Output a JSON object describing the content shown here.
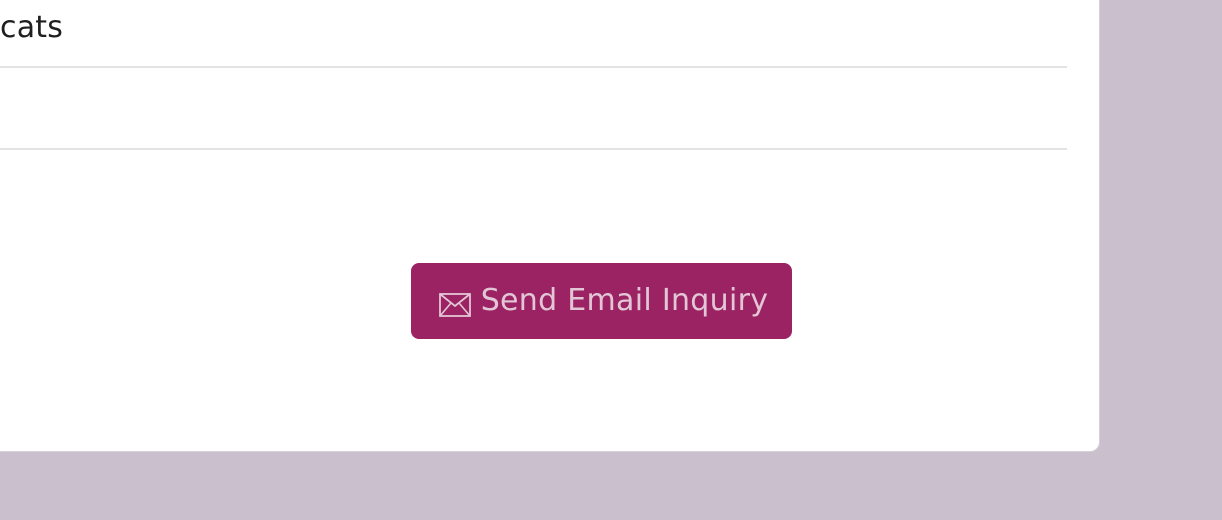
{
  "row": {
    "text": "cats"
  },
  "actions": {
    "send_email_label": "Send Email Inquiry",
    "send_email_icon": "envelope-icon"
  },
  "colors": {
    "background": "#c9bfcd",
    "card": "#ffffff",
    "button": "#9b2263",
    "button_text": "#e3c6d6"
  }
}
